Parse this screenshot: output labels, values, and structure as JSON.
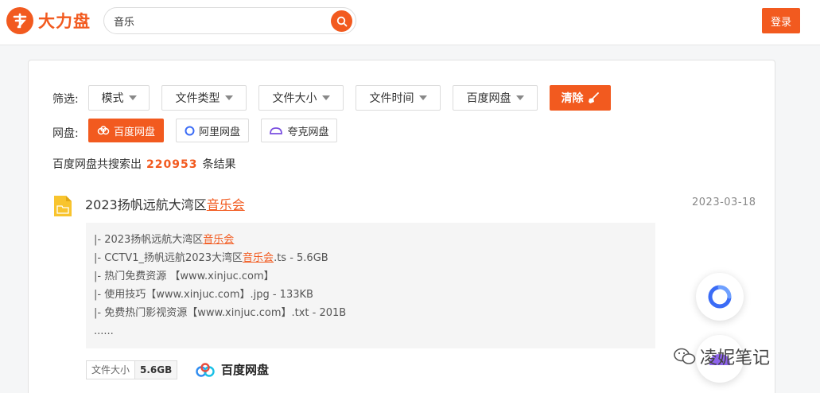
{
  "header": {
    "logo_text": "大力盘",
    "search_value": "音乐",
    "login_label": "登录"
  },
  "filters": {
    "label": "筛选:",
    "options": [
      "模式",
      "文件类型",
      "文件大小",
      "文件时间",
      "百度网盘"
    ],
    "clear_label": "清除"
  },
  "disks": {
    "label": "网盘:",
    "items": [
      "百度网盘",
      "阿里网盘",
      "夸克网盘"
    ],
    "active": "百度网盘"
  },
  "result_count": {
    "prefix": "百度网盘共搜索出",
    "count": "220953",
    "suffix": "条结果"
  },
  "result": {
    "title_pre": "2023扬帆远航大湾区",
    "title_hl": "音乐会",
    "date": "2023-03-18",
    "files": [
      {
        "pre": "|- 2023扬帆远航大湾区",
        "hl": "音乐会",
        "post": ""
      },
      {
        "pre": "|- CCTV1_扬帆远航2023大湾区",
        "hl": "音乐会",
        "post": ".ts - 5.6GB"
      },
      {
        "pre": "|- 热门免费资源 【www.xinjuc.com】",
        "hl": "",
        "post": ""
      },
      {
        "pre": "|- 使用技巧【www.xinjuc.com】.jpg - 133KB",
        "hl": "",
        "post": ""
      },
      {
        "pre": "|- 免费热门影视资源【www.xinjuc.com】.txt - 201B",
        "hl": "",
        "post": ""
      },
      {
        "pre": "......",
        "hl": "",
        "post": ""
      }
    ],
    "size_label": "文件大小",
    "size_value": "5.6GB",
    "provider": "百度网盘"
  },
  "watermark": "凌妮笔记",
  "colors": {
    "accent": "#f25a1f"
  }
}
